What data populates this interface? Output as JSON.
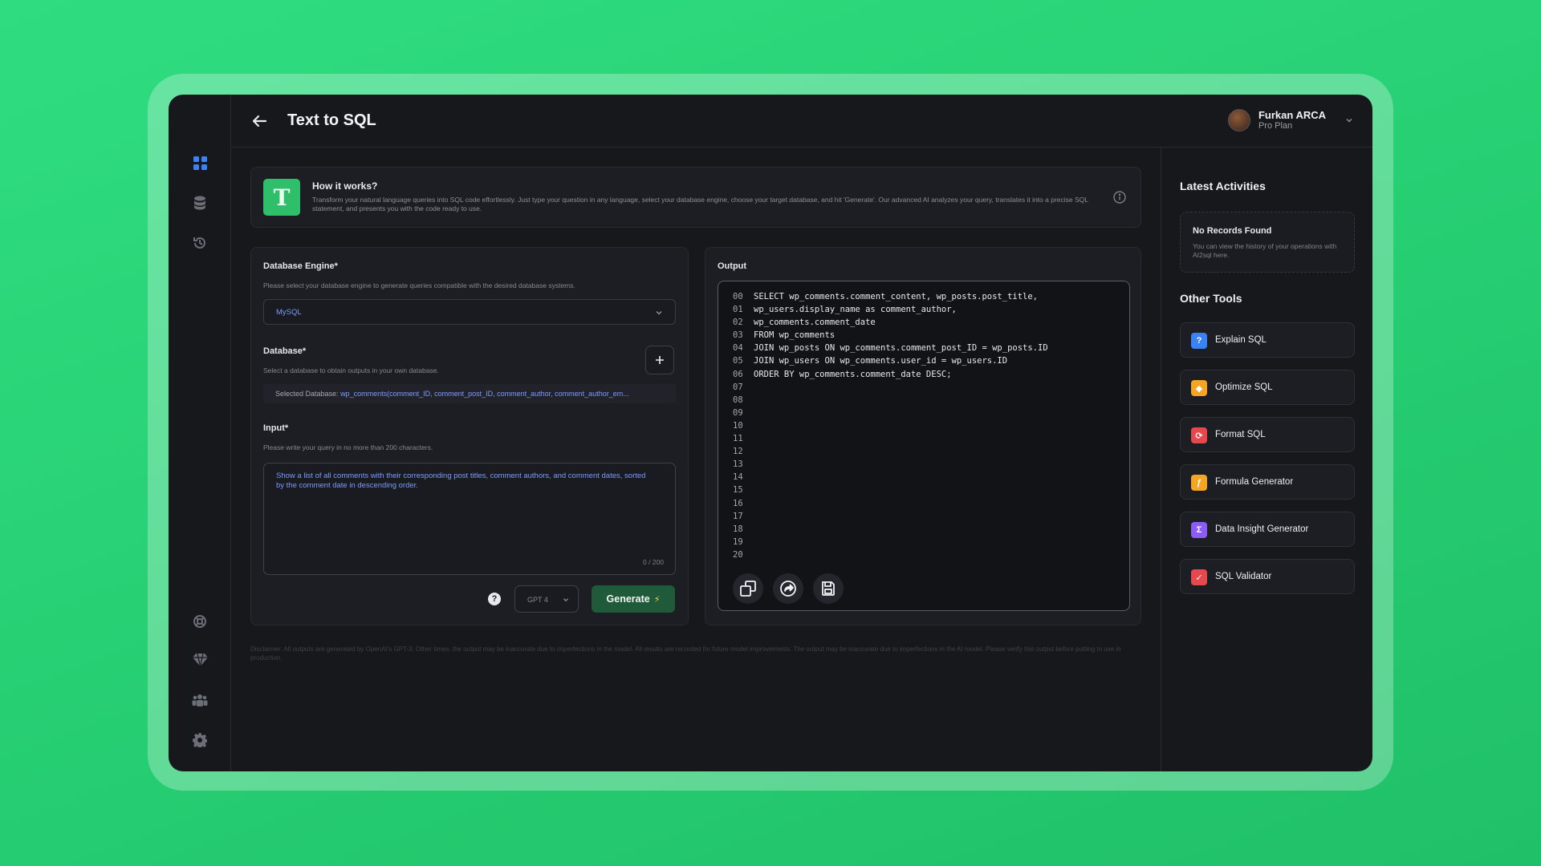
{
  "header": {
    "title": "Text to SQL",
    "user_name": "Furkan ARCA",
    "user_plan": "Pro Plan"
  },
  "sidebar": {
    "items": [
      {
        "icon": "grid-icon",
        "active": true
      },
      {
        "icon": "database-icon",
        "active": false
      },
      {
        "icon": "history-icon",
        "active": false
      },
      {
        "icon": "support-icon",
        "active": false
      },
      {
        "icon": "diamond-icon",
        "active": false
      },
      {
        "icon": "team-icon",
        "active": false
      },
      {
        "icon": "gear-icon",
        "active": false
      }
    ]
  },
  "how_it_works": {
    "title": "How it works?",
    "text": "Transform your natural language queries into SQL code effortlessly. Just type your question in any language, select your database engine, choose your target database, and hit 'Generate'. Our advanced AI analyzes your query, translates it into a precise SQL statement, and presents you with the code ready to use."
  },
  "form": {
    "engine_label": "Database Engine*",
    "engine_help": "Please select your database engine to generate queries compatible with the desired database systems.",
    "engine_value": "MySQL",
    "database_label": "Database*",
    "database_help": "Select a database to obtain outputs in your own database.",
    "selected_db_prefix": "Selected Database: ",
    "selected_db_value": "wp_comments(comment_ID, comment_post_ID, comment_author, comment_author_em...",
    "input_label": "Input*",
    "input_help": "Please write your query in no more than 200 characters.",
    "input_value": "Show a list of all comments with their corresponding post titles, comment authors, and comment dates, sorted by the comment date in descending order.",
    "counter": "0 / 200",
    "model_value": "GPT 4",
    "generate_label": "Generate"
  },
  "output": {
    "title": "Output",
    "lines": [
      {
        "n": "00",
        "code": "SELECT wp_comments.comment_content, wp_posts.post_title,"
      },
      {
        "n": "01",
        "code": "wp_users.display_name as comment_author,"
      },
      {
        "n": "02",
        "code": "wp_comments.comment_date"
      },
      {
        "n": "03",
        "code": "FROM wp_comments"
      },
      {
        "n": "04",
        "code": "JOIN wp_posts ON wp_comments.comment_post_ID = wp_posts.ID"
      },
      {
        "n": "05",
        "code": "JOIN wp_users ON wp_comments.user_id = wp_users.ID"
      },
      {
        "n": "06",
        "code": "ORDER BY wp_comments.comment_date DESC;"
      },
      {
        "n": "07",
        "code": ""
      },
      {
        "n": "08",
        "code": ""
      },
      {
        "n": "09",
        "code": ""
      },
      {
        "n": "10",
        "code": ""
      },
      {
        "n": "11",
        "code": ""
      },
      {
        "n": "12",
        "code": ""
      },
      {
        "n": "13",
        "code": ""
      },
      {
        "n": "14",
        "code": ""
      },
      {
        "n": "15",
        "code": ""
      },
      {
        "n": "16",
        "code": ""
      },
      {
        "n": "17",
        "code": ""
      },
      {
        "n": "18",
        "code": ""
      },
      {
        "n": "19",
        "code": ""
      },
      {
        "n": "20",
        "code": ""
      }
    ],
    "actions": [
      "copy-icon",
      "share-icon",
      "save-icon"
    ]
  },
  "disclaimer": "Disclaimer: All outputs are generated by OpenAI's GPT-3. Other times, the output may be inaccurate due to imperfections in the model. All results are recorded for future model improvements. The output may be inaccurate due to imperfections in the AI model. Please verify this output before putting to use in production.",
  "right_panel": {
    "activities_title": "Latest Activities",
    "empty_title": "No Records Found",
    "empty_text": "You can view the history of your operations with AI2sql here.",
    "tools_title": "Other Tools",
    "tools": [
      {
        "label": "Explain SQL",
        "icon": "explain-icon",
        "color": "#3b82f6",
        "glyph": "?"
      },
      {
        "label": "Optimize SQL",
        "icon": "optimize-icon",
        "color": "#f5a524",
        "glyph": "◆"
      },
      {
        "label": "Format SQL",
        "icon": "format-icon",
        "color": "#e5484d",
        "glyph": "⟳"
      },
      {
        "label": "Formula Generator",
        "icon": "formula-icon",
        "color": "#f5a524",
        "glyph": "ƒ"
      },
      {
        "label": "Data Insight Generator",
        "icon": "insight-icon",
        "color": "#8b5cf6",
        "glyph": "Σ"
      },
      {
        "label": "SQL Validator",
        "icon": "validator-icon",
        "color": "#e5484d",
        "glyph": "✓"
      }
    ]
  }
}
